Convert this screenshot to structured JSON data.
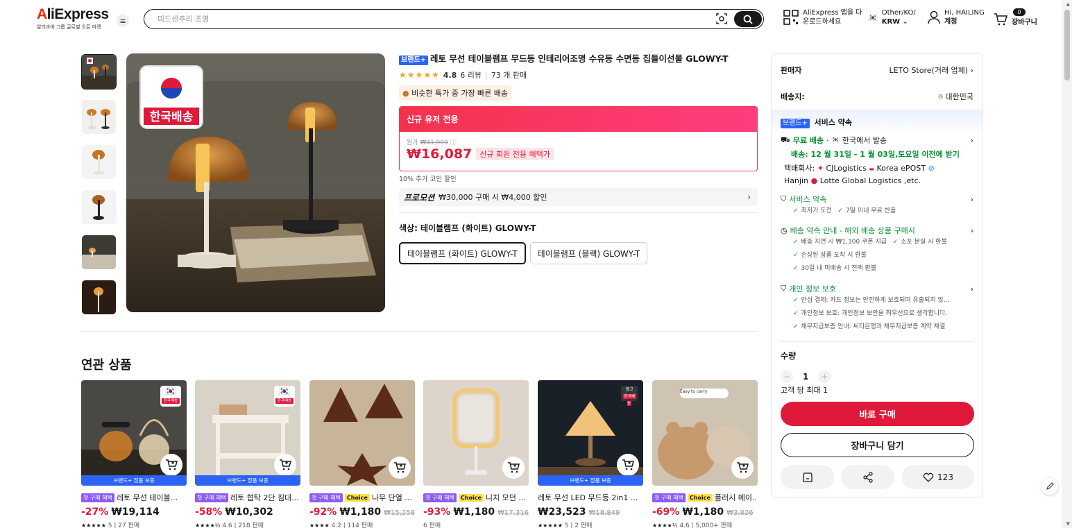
{
  "header": {
    "logo": "AliExpress",
    "logo_sub": "알리바바 그룹 글로벌 오픈 마켓",
    "search_placeholder": "미드센추리 조명",
    "app_line1": "AliExpress 앱을 다",
    "app_line2": "운로드하세요",
    "region_line1": "Other/KO/",
    "region_line2": "KRW",
    "account_line1": "Hi, HAILING",
    "account_line2": "계정",
    "cart_count": "0",
    "cart_label": "장바구니"
  },
  "product": {
    "brand_tag": "브랜드+",
    "title": "레토 무선 테이블램프 무드등 인테리어조명 수유등 수면등 집들이선물 GLOWY-T",
    "rating": "4.8",
    "reviews": "6 리뷰",
    "sold": "73 개 판매",
    "fast_badge": "비슷한 특가 중 가장 빠른 배송",
    "promo_head": "신규 유저 전용",
    "orig_label": "원가",
    "orig_price": "₩41,900",
    "price": "₩16,087",
    "new_tag": "신규 회원 전용 혜택가",
    "coin_note": "10% 추가 코인 할인",
    "promo_label": "프로모션",
    "promo_text": "₩30,000 구매 시 ₩4,000 할인",
    "color_label": "색상: 테이블램프 (화이트) GLOWY-T",
    "color_options": [
      "테이블램프 (화이트) GLOWY-T",
      "테이블램프 (블랙) GLOWY-T"
    ],
    "korea_badge": "한국배송"
  },
  "panel": {
    "seller_label": "판매자",
    "seller_value": "LETO Store(거래 업체)",
    "ship_label": "배송지:",
    "ship_value": "대한민국",
    "brand_tag": "브랜드+",
    "svc_title": "서비스 약속",
    "free_ship": "무료 배송",
    "ship_from": "한국에서 발송",
    "delivery": "배송: 12 월 31일 - 1 월 03일,토요일 이전에 받기",
    "courier_label": "택배회사:",
    "couriers_1": "CJLogistics",
    "couriers_2": "Korea ePOST",
    "couriers_3": "Hanjin",
    "couriers_4": "Lotte Global Logistics ,etc.",
    "svc2_title": "서비스 약속",
    "svc2_items": [
      "최저가 도전",
      "7일 이내 무료 반품"
    ],
    "svc3_title": "배송 약속 안내 - 해외 배송 상품 구매시",
    "svc3_items": [
      "배송 지연 시 ₩1,300 쿠폰 지급",
      "소포 분실 시 환불",
      "손상된 상품 도착 시 환불",
      "30일 내 미배송 시 전액 환불"
    ],
    "svc4_title": "개인 정보 보호",
    "svc4_items": [
      "안심 결제: 카드 정보는 안전하게 보호되며 유출되지 않...",
      "개인정보 보호: 개인정보 보안을 최우선으로 생각합니다.",
      "채무지급보증 안내: 씨티은행과 채무지급보증 계약 체결"
    ],
    "qty_label": "수량",
    "qty_value": "1",
    "qty_max": "고객 당 최대 1",
    "buy_label": "바로 구매",
    "cart_label": "장바구니 담기",
    "wish_count": "123"
  },
  "related": {
    "title": "연관 상품",
    "items": [
      {
        "tags": [
          "first"
        ],
        "name": "레토 무선 테이블...",
        "disc": "-27%",
        "price": "₩19,114",
        "orig": "",
        "stars": "★★★★★",
        "rating": "5",
        "sold": "27 판매",
        "bar": "브랜드+ 정품 보증",
        "badge": "kr"
      },
      {
        "tags": [
          "first"
        ],
        "name": "레토 협탁 2단 침대...",
        "disc": "-58%",
        "price": "₩10,302",
        "orig": "",
        "stars": "★★★★½",
        "rating": "4.6",
        "sold": "218 판매",
        "bar": "브랜드+ 정품 보증",
        "badge": "kr"
      },
      {
        "tags": [
          "first",
          "choice"
        ],
        "name": "나무 단열 ...",
        "disc": "-92%",
        "price": "₩1,180",
        "orig": "₩15,258",
        "stars": "★★★★",
        "rating": "4.2",
        "sold": "114 판매",
        "bar": "",
        "badge": ""
      },
      {
        "tags": [
          "first",
          "choice"
        ],
        "name": "니치 모던 ...",
        "disc": "-93%",
        "price": "₩1,180",
        "orig": "₩17,316",
        "stars": "",
        "rating": "",
        "sold": "6 판매",
        "bar": "",
        "badge": ""
      },
      {
        "tags": [],
        "name": "레토 무선 LED 무드등 2in1 ...",
        "disc": "",
        "price": "₩23,523",
        "orig": "₩18,849",
        "stars": "★★★★★",
        "rating": "5",
        "sold": "2 판매",
        "bar": "브랜드+ 정품 보증",
        "badge": "ad"
      },
      {
        "tags": [
          "first",
          "choice"
        ],
        "name": "플러시 메이...",
        "disc": "-69%",
        "price": "₩1,180",
        "orig": "₩3,826",
        "stars": "★★★★½",
        "rating": "4.6",
        "sold": "5,000+ 판매",
        "bar": "",
        "badge": ""
      }
    ],
    "tag_first": "첫 구매 혜택",
    "tag_choice": "Choice",
    "kr_badge_text": "한국배송",
    "ad_text": "광고",
    "easy_carry": "Easy to carry"
  }
}
